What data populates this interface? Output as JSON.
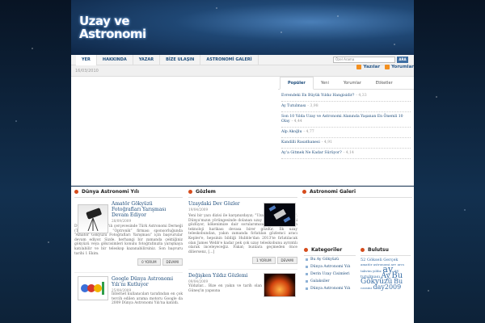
{
  "header": {
    "logo_line1": "Uzay ve",
    "logo_line2": "Astronomi",
    "feeds": {
      "entries": "Yazılar",
      "comments": "Yorumlar"
    }
  },
  "nav": {
    "items": [
      "YER",
      "HAKKINDA",
      "YAZAR",
      "BİZE ULAŞIN",
      "ASTRONOMİ GALERİ"
    ],
    "search_placeholder": "Özel Arama",
    "search_label": "ARA"
  },
  "date": "16/03/2010",
  "tabs": [
    "Popüler",
    "Yeni",
    "Yorumlar",
    "Etiketler"
  ],
  "popular": [
    {
      "title": "Evrendeki En Büyük Yıldız Hangisidir?",
      "votes": "- 4,33"
    },
    {
      "title": "Ay Tutulması",
      "votes": "- 3,98"
    },
    {
      "title": "Son 10 Yılda Uzay ve Astronomi Alanında Yaşanan En Önemli 10 Olay",
      "votes": "- 4,44"
    },
    {
      "title": "Alp Akoğlu",
      "votes": "- 4,77"
    },
    {
      "title": "Kandilli Rasathanesi",
      "votes": "- 4,91"
    },
    {
      "title": "Ay’a Gitmek Ne Kadar Sürüyor?",
      "votes": "- 4,14"
    }
  ],
  "columns": {
    "c1_title": "Dünya Astronomi Yılı",
    "c2_title": "Gözlem",
    "c3_title": "Astronomi Galeri"
  },
  "posts": {
    "p1": {
      "title": "Amatör Gökyüzü Fotoğrafları Yarışması Devam Ediyor",
      "date": "28/09/2009",
      "body": "Dünya Astronomi Yılı çerçevesinde Türk Astronomi Derneği (TAD) tarafından “Optronik” firması sponsorluğunda “Amatör Gökyüzü Fotoğrafları Yarışması” için başvurular devam ediyor. Sizde, herhangi bir zamanda çektiğiniz gökyüzü veya gökcisimleri konulu fotoğrafınızla yarışmaya katılabilir ve bir teleskop kazanabilirsiniz. Son başvuru tarihi 1 Ekim.",
      "comments": "0 YORUM",
      "more": "DEVAMI"
    },
    "p2": {
      "title": "Google Dünya Astronomi Yılı’nı Kutluyor",
      "date": "25/08/2009",
      "body": "İnternet kullanıcıları tarafından en çok tercih edilen arama motoru Google da 2009 Dünya Astronomi Yılı'na katıldı."
    },
    "p3": {
      "title": "Uzaydaki Dev Gözler",
      "date": "19/04/2009",
      "body": "Yeni bir yazı dizisi ile karşınızdayız; \"Uzaydaki Dev Gözler\". Dünya'mızın yörüngesinde dolanan uzay teleskopları evreni gözlüyor, kökenimize dair sorularımıza cevaplar arayan teknoloji harikası devasa birer gözdür. İlk uzay teleskobundan, yakın zamanda fırlatılan gözlemci aracı Kepler'e, hepsinin bildiği Hubble'dan 2013'te fırlatılacak olan James Webb'e kadar pek çok uzay teleskobunu ayrıntılı olarak inceleyeceğiz. Fakat; bunlara geçmeden önce diliersenz, [...]",
      "comments": "1 YORUM",
      "more": "DEVAMI"
    },
    "p4": {
      "title": "Değişken Yıldız Gözlemi",
      "date": "09/04/2009",
      "body": "Yıldızlar... Bize en yakın ve tarih olan Güneş'in yapısına"
    }
  },
  "sidebar": {
    "cat_title": "Kategoriler",
    "categories": [
      "Bu Ay Gökyüzü",
      "Dünya Astronomi Yılı",
      "Derin Uzay Cisimleri",
      "Galaksiler",
      "Dünya Astronomi Yılı"
    ],
    "cloud_title": "Bulutsu",
    "cloud": [
      "52 Gökseli Gerçek",
      "amatör astronomi arv",
      "arcs takvim yıldız",
      "ay",
      "ay tutulması",
      "Ay",
      "Bu",
      "Gökyüzü",
      "Bu",
      "cassini",
      "day2009"
    ]
  },
  "colors": {
    "accent": "#1d4c7b",
    "bullet": "#d64c1c",
    "search_btn": "#3f6fa3"
  },
  "icons": {
    "feed": "rss-icon",
    "bullet": "circle-bullet-icon"
  }
}
